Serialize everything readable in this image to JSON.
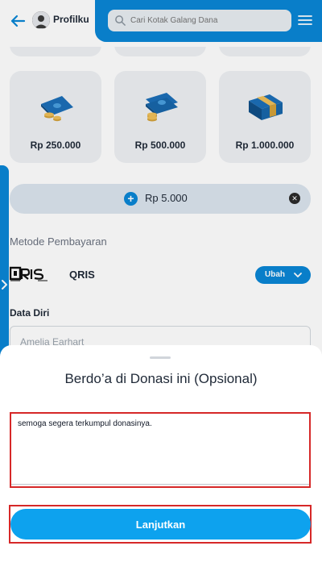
{
  "header": {
    "profile_label": "Profilku",
    "search_placeholder": "Cari Kotak Galang Dana"
  },
  "nominal_cards": [
    {
      "amount": "Rp 250.000",
      "icon": "money-stack-small-icon"
    },
    {
      "amount": "Rp 500.000",
      "icon": "money-stack-medium-icon"
    },
    {
      "amount": "Rp 1.000.000",
      "icon": "money-stack-large-icon"
    }
  ],
  "custom_amount": "Rp 5.000",
  "payment": {
    "section_title": "Metode Pembayaran",
    "method_name": "QRIS",
    "change_label": "Ubah"
  },
  "personal": {
    "section_title": "Data Diri",
    "name_value": "Amelia Earhart"
  },
  "sheet": {
    "title": "Berdo’a di Donasi ini (Opsional)",
    "prayer_text": "semoga segera terkumpul donasinya.",
    "submit_label": "Lanjutkan"
  },
  "colors": {
    "primary": "#0a86d6",
    "button": "#0da2ee",
    "highlight": "#d62828"
  }
}
